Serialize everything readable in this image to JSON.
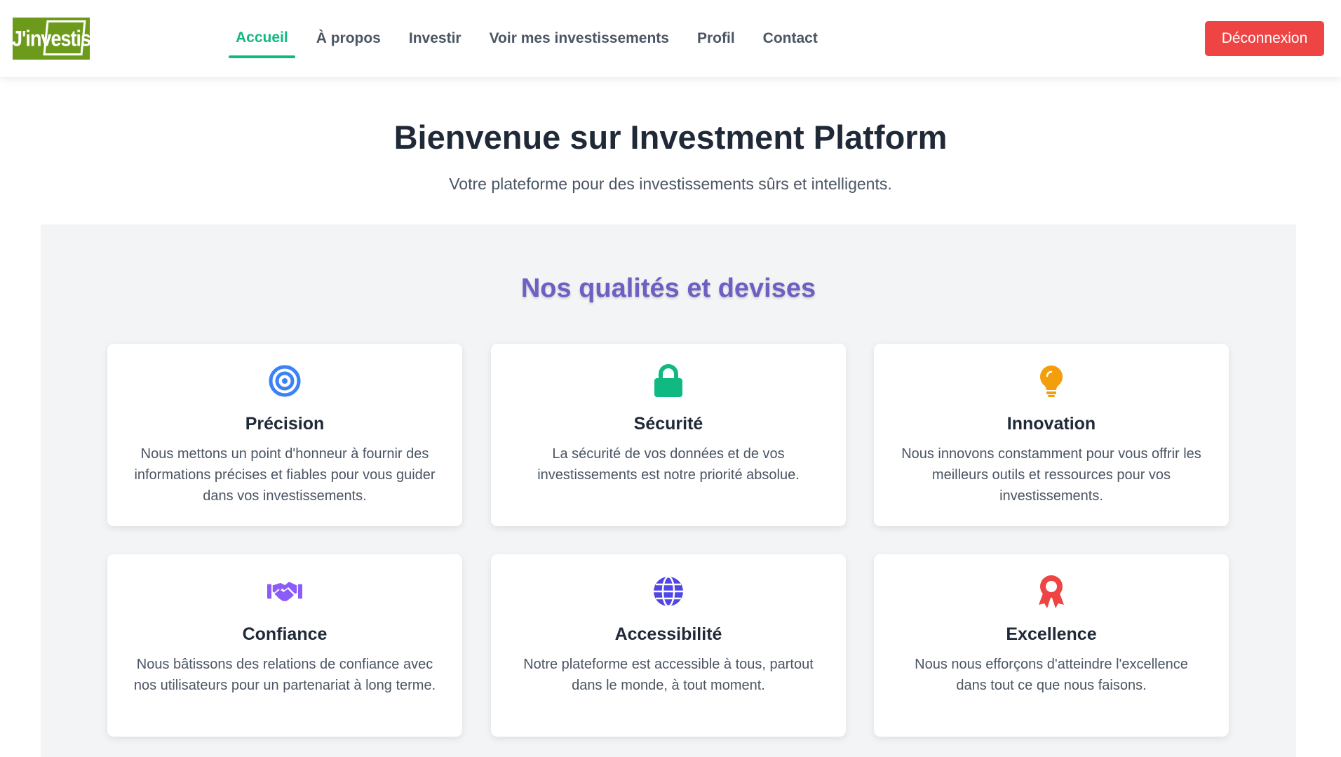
{
  "header": {
    "logo_text": "J'investis",
    "nav": [
      {
        "label": "Accueil",
        "active": true
      },
      {
        "label": "À propos",
        "active": false
      },
      {
        "label": "Investir",
        "active": false
      },
      {
        "label": "Voir mes investissements",
        "active": false
      },
      {
        "label": "Profil",
        "active": false
      },
      {
        "label": "Contact",
        "active": false
      }
    ],
    "logout_label": "Déconnexion"
  },
  "hero": {
    "title": "Bienvenue sur Investment Platform",
    "subtitle": "Votre plateforme pour des investissements sûrs et intelligents."
  },
  "qualities": {
    "title": "Nos qualités et devises",
    "cards": [
      {
        "icon": "target-icon",
        "color": "#3b82f6",
        "title": "Précision",
        "text": "Nous mettons un point d'honneur à fournir des informations précises et fiables pour vous guider dans vos investissements."
      },
      {
        "icon": "lock-icon",
        "color": "#10b981",
        "title": "Sécurité",
        "text": "La sécurité de vos données et de vos investissements est notre priorité absolue."
      },
      {
        "icon": "lightbulb-icon",
        "color": "#f59e0b",
        "title": "Innovation",
        "text": "Nous innovons constamment pour vous offrir les meilleurs outils et ressources pour vos investissements."
      },
      {
        "icon": "handshake-icon",
        "color": "#8b5cf6",
        "title": "Confiance",
        "text": "Nous bâtissons des relations de confiance avec nos utilisateurs pour un partenariat à long terme."
      },
      {
        "icon": "globe-icon",
        "color": "#4f46e5",
        "title": "Accessibilité",
        "text": "Notre plateforme est accessible à tous, partout dans le monde, à tout moment."
      },
      {
        "icon": "award-icon",
        "color": "#ef4444",
        "title": "Excellence",
        "text": "Nous nous efforçons d'atteindre l'excellence dans tout ce que nous faisons."
      }
    ]
  },
  "colors": {
    "accent": "#10b981",
    "danger": "#ef4444",
    "section_title": "#6d5fc4",
    "logo_bg": "#6c9a1a"
  }
}
